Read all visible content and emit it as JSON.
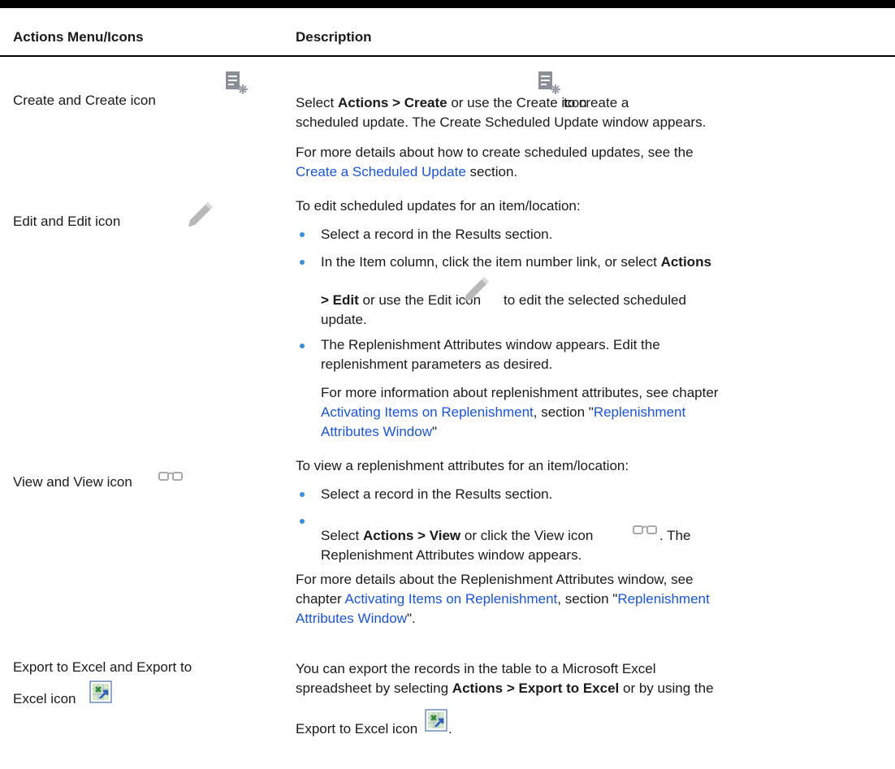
{
  "header": {
    "col1": "Actions Menu/Icons",
    "col2": "Description"
  },
  "rows": {
    "create": {
      "label": "Create and Create icon",
      "icon": "create-doc-star-icon",
      "d1a": "Select ",
      "d1b": "Actions > Create",
      "d1c": " or use the Create icon",
      "d1d": " to create a",
      "d2": "scheduled update. The Create Scheduled Update window appears.",
      "d3": "For more details about how to create scheduled updates, see the",
      "d4_link": "Create a Scheduled Update",
      "d4_rest": " section."
    },
    "edit": {
      "label": "Edit and Edit icon",
      "icon": "pencil-icon",
      "intro": "To edit scheduled updates for an item/location:",
      "b1": "Select a record in the Results section.",
      "b2a": "In the Item column, click the item number link, or select ",
      "b2b": "Actions",
      "b2c": "> Edit",
      "b2d": " or use the Edit icon",
      "b2e": "to edit the selected scheduled",
      "b2f": "update.",
      "b3a": "The Replenishment Attributes window appears. Edit the",
      "b3b": "replenishment parameters as desired.",
      "p1": "For more information about replenishment attributes, see chapter",
      "p2_link1": "Activating Items on Replenishment",
      "p2_mid": ", section \"",
      "p2_link2": "Replenishment",
      "p3_link": "Attributes Window",
      "p3_rest": "\""
    },
    "view": {
      "label": "View and View icon",
      "icon": "glasses-icon",
      "intro": "To view a replenishment attributes for an item/location:",
      "b1": "Select a record in the Results section.",
      "b2a": "Select ",
      "b2b": "Actions > View",
      "b2c": " or click the View icon",
      "b2d": ". The",
      "b2e": "Replenishment Attributes window appears.",
      "p1": "For more details about the Replenishment Attributes window, see",
      "p2a": "chapter ",
      "p2_link1": "Activating Items on Replenishment",
      "p2_mid": ", section \"",
      "p2_link2": "Replenishment",
      "p3_link": "Attributes Window",
      "p3_rest": "\"."
    },
    "export": {
      "label1": "Export to Excel and Export to",
      "label2": "Excel icon",
      "icon": "excel-export-icon",
      "d1": "You can export the records in the table to a Microsoft Excel",
      "d2a": "spreadsheet by selecting ",
      "d2b": "Actions > Export to Excel",
      "d2c": " or by using the",
      "d3a": "Export to Excel icon",
      "d3b": "."
    }
  },
  "colors": {
    "link": "#1a55d6",
    "bullet": "#3a8ed8",
    "text": "#1a1a1a"
  }
}
